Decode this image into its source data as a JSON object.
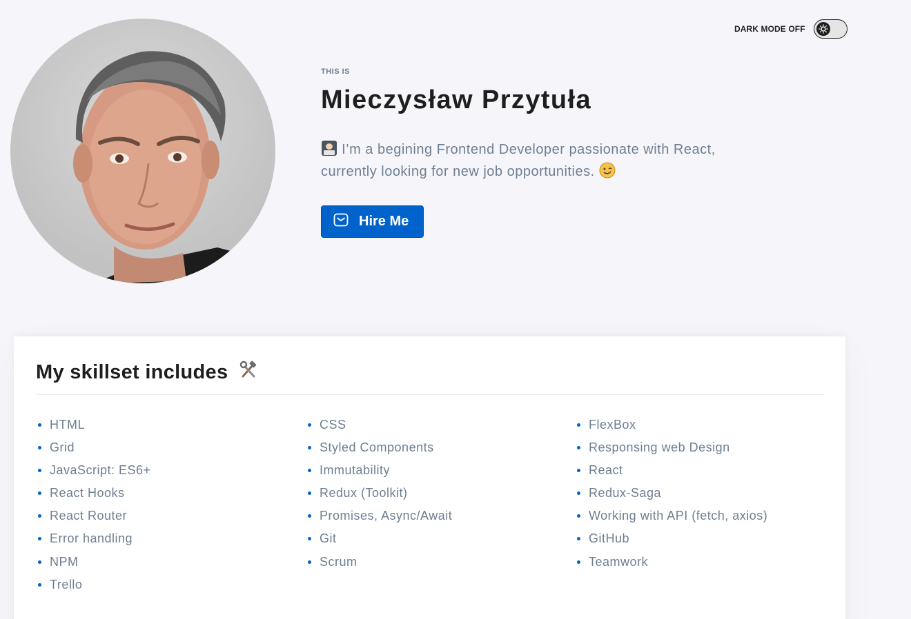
{
  "theme_toggle": {
    "label": "DARK MODE OFF",
    "state": "off"
  },
  "header": {
    "eyebrow": "THIS IS",
    "name": "Mieczysław Przytuła",
    "bio_line1": "I’m a begining Frontend Developer passionate with React,",
    "bio_line2": "currently looking for new job opportunities.",
    "bio_leading_icon": "technologist-emoji",
    "bio_trailing_icon": "winking-face-emoji",
    "hire_button": {
      "label": "Hire Me",
      "icon": "mail-icon"
    }
  },
  "skills": {
    "title": "My skillset includes",
    "title_icon": "hammer-and-wrench-emoji",
    "items": [
      "HTML",
      "CSS",
      "FlexBox",
      "Grid",
      "Styled Components",
      "Responsing web Design",
      "JavaScript: ES6+",
      "Immutability",
      "React",
      "React Hooks",
      "Redux (Toolkit)",
      "Redux-Saga",
      "React Router",
      "Promises, Async/Await",
      "Working with API (fetch, axios)",
      "Error handling",
      "Git",
      "GitHub",
      "NPM",
      "Scrum",
      "Teamwork",
      "Trello"
    ]
  },
  "colors": {
    "background": "#f6f6fa",
    "accent": "#0063cc",
    "text_primary": "#1e1e1e",
    "text_secondary": "#6e7e91",
    "card": "#ffffff"
  }
}
